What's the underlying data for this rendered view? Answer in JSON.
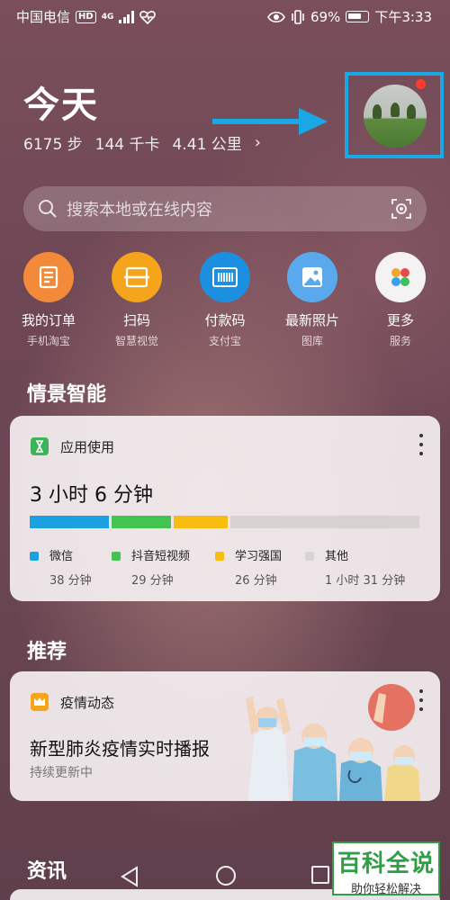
{
  "status_bar": {
    "carrier": "中国电信",
    "network_badge": "HD",
    "network_type": "4G",
    "battery": "69%",
    "time": "下午3:33",
    "icons": [
      "eye-icon",
      "vibrate-icon",
      "battery-icon",
      "heart-pulse-icon"
    ]
  },
  "header": {
    "title": "今天",
    "steps": "6175 步",
    "calories": "144 千卡",
    "distance": "4.41 公里"
  },
  "avatar": {
    "highlight_color": "#1aa7e6",
    "badge_color": "#ff3b30"
  },
  "search": {
    "placeholder": "搜索本地或在线内容"
  },
  "quick_actions": [
    {
      "label": "我的订单",
      "sub": "手机淘宝",
      "icon": "document-icon",
      "color": "#f28a3a"
    },
    {
      "label": "扫码",
      "sub": "智慧视觉",
      "icon": "scan-icon",
      "color": "#f5a51c"
    },
    {
      "label": "付款码",
      "sub": "支付宝",
      "icon": "barcode-icon",
      "color": "#1d8fe0"
    },
    {
      "label": "最新照片",
      "sub": "图库",
      "icon": "photo-icon",
      "color": "#5aa9ec"
    },
    {
      "label": "更多",
      "sub": "服务",
      "icon": "more-apps-icon",
      "color": "#f4f2f3"
    }
  ],
  "section_scene": {
    "title": "情景智能"
  },
  "app_usage": {
    "title": "应用使用",
    "total": "3 小时 6 分钟",
    "items": [
      {
        "name": "微信",
        "duration": "38 分钟",
        "minutes": 38,
        "color": "#1ba1e2"
      },
      {
        "name": "抖音短视频",
        "duration": "29 分钟",
        "minutes": 29,
        "color": "#43c34f"
      },
      {
        "name": "学习强国",
        "duration": "26 分钟",
        "minutes": 26,
        "color": "#f9bd12"
      },
      {
        "name": "其他",
        "duration": "1 小时 31 分钟",
        "minutes": 91,
        "color": "#d8d2d3"
      }
    ]
  },
  "section_recommend": {
    "title": "推荐"
  },
  "recommend_card": {
    "tag": "疫情动态",
    "title": "新型肺炎疫情实时播报",
    "subtitle": "持续更新中"
  },
  "section_news": {
    "title": "资讯"
  },
  "watermark": {
    "title": "百科全说",
    "subtitle": "助你轻松解决"
  }
}
